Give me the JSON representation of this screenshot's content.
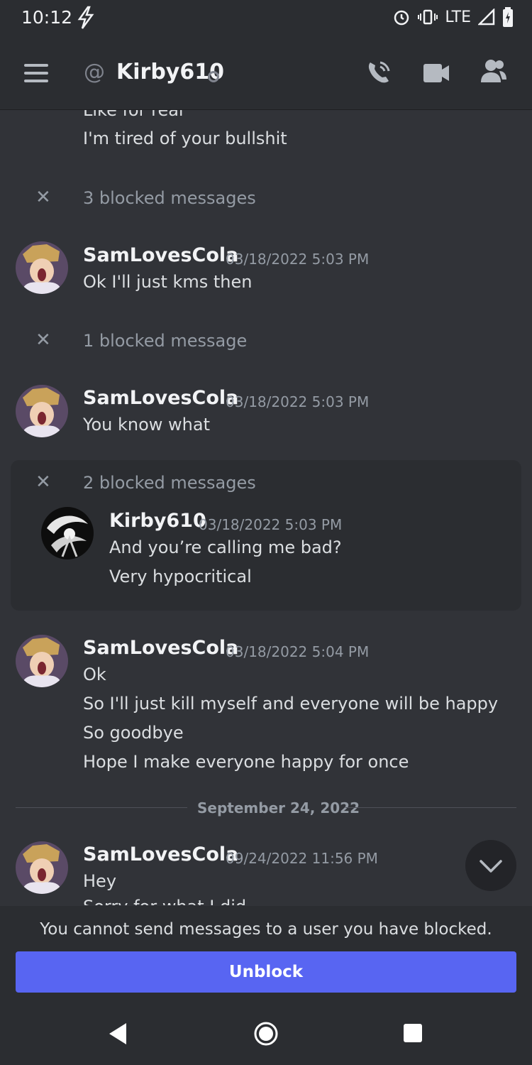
{
  "status_bar": {
    "time": "10:12",
    "network": "LTE"
  },
  "header": {
    "title": "Kirby610"
  },
  "messages": {
    "partial_top_line": "Like for real",
    "line_tired": "I'm tired of your bullshit",
    "blocked_1": "3 blocked messages",
    "msg1": {
      "username": "SamLovesCola",
      "timestamp": "03/18/2022 5:03 PM",
      "lines": [
        "Ok I'll just kms then"
      ]
    },
    "blocked_2": "1 blocked message",
    "msg2": {
      "username": "SamLovesCola",
      "timestamp": "03/18/2022 5:03 PM",
      "lines": [
        "You know what"
      ]
    },
    "blocked_3": {
      "label": "2 blocked messages",
      "message": {
        "username": "Kirby610",
        "timestamp": "03/18/2022 5:03 PM",
        "lines": [
          "And you’re calling me bad?",
          "Very hypocritical"
        ]
      }
    },
    "msg3": {
      "username": "SamLovesCola",
      "timestamp": "03/18/2022 5:04 PM",
      "lines": [
        "Ok",
        "So I'll just kill myself and everyone will be happy",
        "So goodbye",
        "Hope I make everyone happy for once"
      ]
    },
    "date_divider": "September 24, 2022",
    "msg4": {
      "username": "SamLovesCola",
      "timestamp": "09/24/2022 11:56 PM",
      "lines": [
        "Hey",
        "Sorry for what I did"
      ]
    }
  },
  "footer": {
    "notice": "You cannot send messages to a user you have blocked.",
    "unblock_label": "Unblock"
  },
  "colors": {
    "accent": "#5865f2",
    "background": "#313338",
    "header": "#2b2d31"
  }
}
